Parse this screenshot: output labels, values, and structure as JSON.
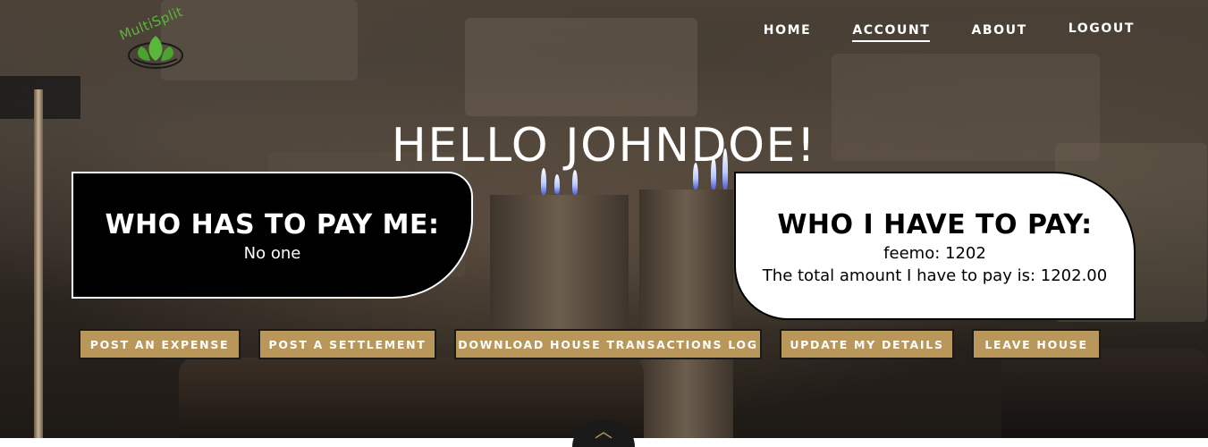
{
  "brand": {
    "name": "MultiSplit"
  },
  "nav": {
    "items": [
      {
        "label": "HOME"
      },
      {
        "label": "ACCOUNT"
      },
      {
        "label": "ABOUT"
      },
      {
        "label": "LOGOUT"
      }
    ],
    "active": "ACCOUNT"
  },
  "greeting": "HELLO JOHNDOE!",
  "pay_me": {
    "title": "WHO HAS TO PAY ME:",
    "text": "No one"
  },
  "i_pay": {
    "title": "WHO I HAVE TO PAY:",
    "lines": [
      "feemo: 1202",
      "The total amount I have to pay is: 1202.00"
    ]
  },
  "actions": [
    {
      "label": "POST AN EXPENSE"
    },
    {
      "label": "POST A SETTLEMENT"
    },
    {
      "label": "DOWNLOAD HOUSE TRANSACTIONS LOG"
    },
    {
      "label": "UPDATE MY DETAILS"
    },
    {
      "label": "LEAVE HOUSE"
    }
  ],
  "colors": {
    "accent": "#b9975b",
    "brand_green": "#59b83a"
  },
  "icons": {
    "logo": "leaf-logo-icon",
    "scroll": "chevron-up-icon"
  }
}
